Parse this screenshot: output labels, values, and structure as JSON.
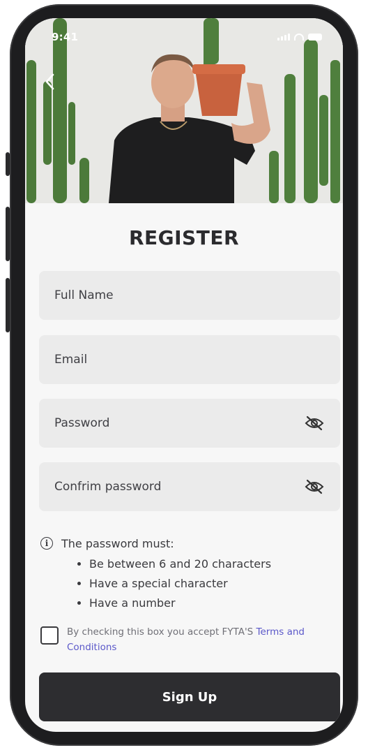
{
  "status_bar": {
    "time": "9:41"
  },
  "header": {
    "title": "REGISTER"
  },
  "form": {
    "full_name_placeholder": "Full Name",
    "email_placeholder": "Email",
    "password_placeholder": "Password",
    "confirm_password_placeholder": "Confrim password"
  },
  "password_rules": {
    "heading": "The password must:",
    "items": [
      "Be between 6 and 20 characters",
      "Have a special character",
      "Have a number"
    ]
  },
  "terms": {
    "text": "By checking this box you accept FYTA'S ",
    "link": "Terms and Conditions",
    "checked": false
  },
  "signup": {
    "label": "Sign Up"
  },
  "colors": {
    "accent_link": "#5b58c9",
    "button_bg": "#2d2d30",
    "field_bg": "#ebebeb"
  },
  "icons": [
    "back-chevron-icon",
    "eye-off-icon",
    "info-icon",
    "signal-icon",
    "wifi-icon",
    "battery-icon"
  ]
}
